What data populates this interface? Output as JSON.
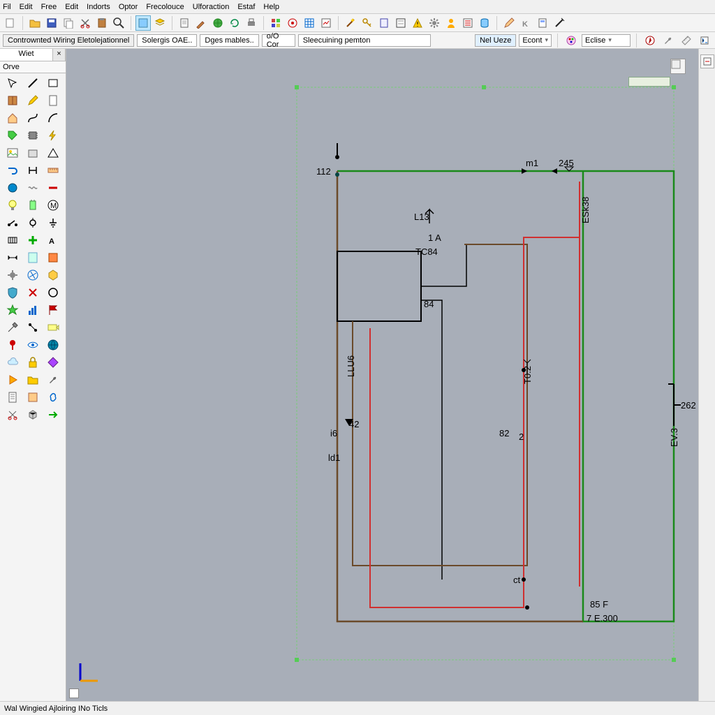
{
  "menu": {
    "items": [
      "Fil",
      "Edit",
      "Free",
      "Edit",
      "Indorts",
      "Optor",
      "Frecolouce",
      "Ulforaction",
      "Estaf",
      "Help"
    ]
  },
  "breadcrumb": {
    "items": [
      "Contrownted Wiring Eletolejationnel",
      "Solergis OAE..",
      "Dges mables..",
      "o/O Cor",
      "Sleecuining pemton"
    ],
    "right": {
      "dropdown1": "Nel Ueze",
      "dropdown2": "Econt",
      "echise": "Eclise"
    }
  },
  "side": {
    "tab_wiet": "Wiet",
    "tab_close": "×",
    "sub_orve": "Orve"
  },
  "schematic": {
    "labels": {
      "l112": "112",
      "m1": "m1",
      "z45": "245",
      "esk38": "ESk38",
      "l13": "L13",
      "a1": "1  A",
      "tc84": "TC84",
      "b84": "84",
      "llu6": "LLU6",
      "i6": "i6",
      "l42": "42",
      "ld1": "ld1",
      "b82": "82",
      "m2": "2",
      "t02": "T0.2",
      "ct": "ct",
      "l262": "262",
      "ev3": "EV.3",
      "b85f": "85 F",
      "v7e300": "7 E.300"
    }
  },
  "status": {
    "text": "Wal Wingied Ajloiring INo Ticls"
  },
  "colors": {
    "wire_green": "#1a8a1a",
    "wire_red": "#d03030",
    "wire_brown": "#6b4a2a",
    "wire_black": "#000",
    "canvas": "#a8aeb8"
  }
}
